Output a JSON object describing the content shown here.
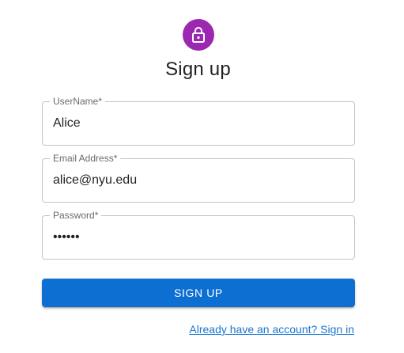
{
  "avatar": {
    "icon": "lock-icon",
    "color": "#9c27b0"
  },
  "title": "Sign up",
  "fields": {
    "username": {
      "label": "UserName",
      "required_mark": "*",
      "value": "Alice"
    },
    "email": {
      "label": "Email Address",
      "required_mark": "*",
      "value": "alice@nyu.edu"
    },
    "password": {
      "label": "Password",
      "required_mark": "*",
      "value": "••••••"
    }
  },
  "submit": {
    "label": "SIGN UP",
    "color": "#1976d2"
  },
  "signin_link": {
    "label": "Already have an account? Sign in",
    "color": "#1976d2"
  }
}
